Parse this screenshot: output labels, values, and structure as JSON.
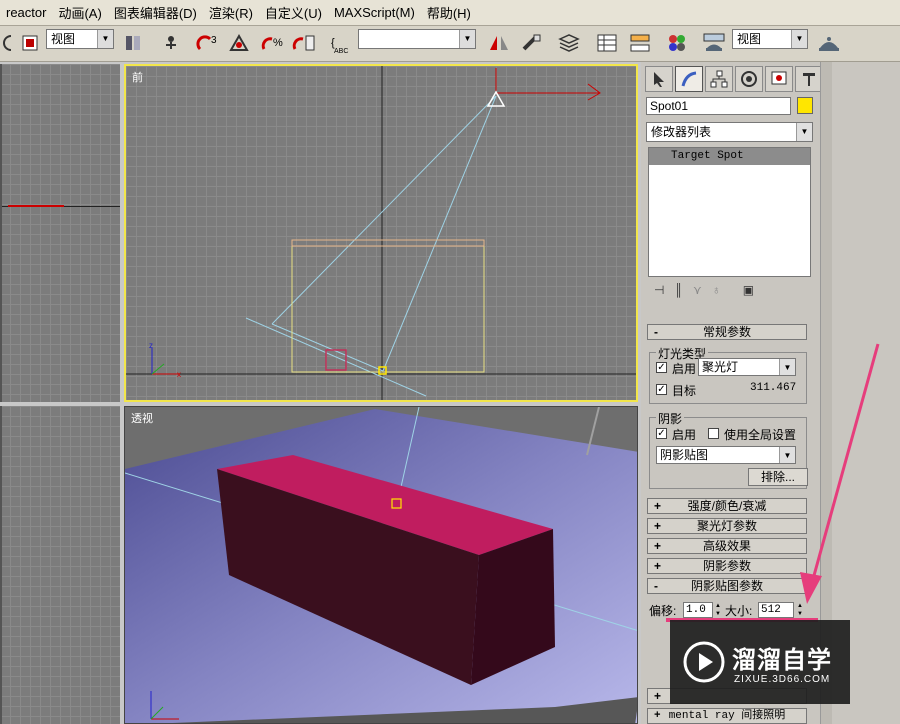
{
  "menu": [
    "reactor",
    "动画(A)",
    "图表编辑器(D)",
    "渲染(R)",
    "自定义(U)",
    "MAXScript(M)",
    "帮助(H)"
  ],
  "toolbar": {
    "view_select_1": "视图",
    "named_select": "",
    "view_select_2": "视图"
  },
  "viewports": {
    "front_label": "前",
    "persp_label": "透视"
  },
  "panel": {
    "object_name": "Spot01",
    "object_color": "#ffe600",
    "modifier_list": "修改器列表",
    "stack_item": "Target Spot",
    "general": {
      "title": "常规参数",
      "light_type_group": "灯光类型",
      "enable_label": "启用",
      "light_type": "聚光灯",
      "target_label": "目标",
      "target_value": "311.467",
      "shadow_group": "阴影",
      "shadow_enable_label": "启用",
      "global_label": "使用全局设置",
      "shadow_type": "阴影贴图",
      "exclude_label": "排除..."
    },
    "rollouts": [
      "强度/颜色/衰减",
      "聚光灯参数",
      "高级效果",
      "阴影参数"
    ],
    "shadow_map": {
      "title": "阴影贴图参数",
      "bias_label": "偏移:",
      "bias_value": "1.0",
      "size_label": "大小:",
      "size_value": "512"
    },
    "mental_ray": "mental ray 间接照明"
  },
  "watermark": {
    "title": "溜溜自学",
    "url": "ZIXUE.3D66.COM"
  }
}
